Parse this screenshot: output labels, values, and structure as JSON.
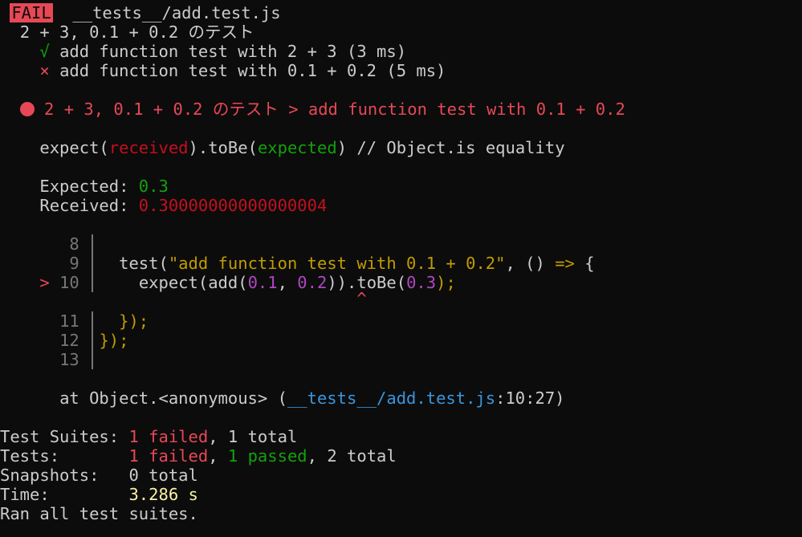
{
  "header": {
    "badge": "FAIL",
    "file": "__tests__/add.test.js"
  },
  "suite": {
    "name": "2 + 3, 0.1 + 0.2 のテスト",
    "tests": [
      {
        "mark": "√",
        "text": "add function test with 2 + 3 (3 ms)",
        "status": "passed"
      },
      {
        "mark": "×",
        "text": "add function test with 0.1 + 0.2 (5 ms)",
        "status": "failed"
      }
    ]
  },
  "failure": {
    "title": "2 + 3, 0.1 + 0.2 のテスト > add function test with 0.1 + 0.2",
    "matcher": {
      "prefix": "expect(",
      "received": "received",
      "middle": ").toBe(",
      "expected": "expected",
      "suffix": ") // Object.is equality"
    },
    "expected_label": "Expected: ",
    "expected_value": "0.3",
    "received_label": "Received: ",
    "received_value": "0.30000000000000004"
  },
  "code_frame": {
    "lines": [
      {
        "num": "8",
        "code": ""
      },
      {
        "num": "9",
        "code_parts": [
          "test(",
          "\"add function test with 0.1 + 0.2\"",
          ", () ",
          "=>",
          " {"
        ]
      },
      {
        "num": "10",
        "pointer": ">",
        "code_parts": [
          "expect(add(",
          "0.1",
          ", ",
          "0.2",
          ")).toBe(",
          "0.3",
          ");"
        ]
      },
      {
        "caret": "^"
      },
      {
        "num": "11",
        "code_parts": [
          "});"
        ]
      },
      {
        "num": "12",
        "code_parts": [
          "});"
        ]
      },
      {
        "num": "13",
        "code": ""
      }
    ],
    "stack": {
      "prefix": "at Object.<anonymous> (",
      "file": "__tests__/add.test.js",
      "location": ":10:27)"
    }
  },
  "summary": {
    "suites_label": "Test Suites: ",
    "suites_failed": "1 failed",
    "suites_total": ", 1 total",
    "tests_label": "Tests:       ",
    "tests_failed": "1 failed",
    "tests_sep": ", ",
    "tests_passed": "1 passed",
    "tests_total": ", 2 total",
    "snapshots_label": "Snapshots:   ",
    "snapshots_value": "0 total",
    "time_label": "Time:        ",
    "time_value": "3.286 s",
    "ran": "Ran all test suites."
  },
  "colors": {
    "background": "#0c0c0c",
    "text": "#cccccc",
    "fail": "#e74856",
    "pass": "#13a10e",
    "time": "#f9f1a5",
    "link": "#3a96dd"
  }
}
